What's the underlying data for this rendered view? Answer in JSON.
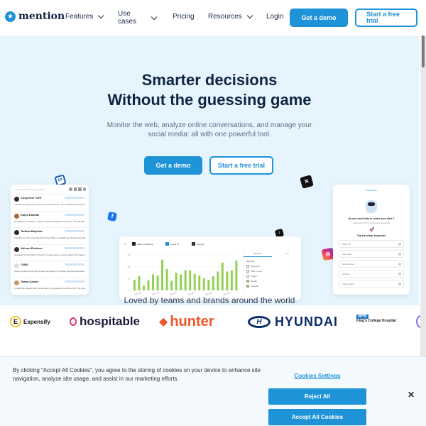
{
  "nav": {
    "logo": "mention",
    "items": [
      {
        "label": "Features",
        "has_dropdown": true
      },
      {
        "label": "Use cases",
        "has_dropdown": true
      },
      {
        "label": "Pricing",
        "has_dropdown": false
      },
      {
        "label": "Resources",
        "has_dropdown": true
      },
      {
        "label": "Login",
        "has_dropdown": false
      }
    ],
    "cta_demo": "Get a demo",
    "cta_trial": "Start a free trial"
  },
  "hero": {
    "title_line1": "Smarter  decisions",
    "title_line2": "Without the guessing game",
    "subtitle": "Monitor the web, analyze online conversations, and manage your social media: all with one powerful tool.",
    "cta_demo": "Get a demo",
    "cta_trial": "Start a free trial"
  },
  "mentions_panel": {
    "search_placeholder": "Explore and filter your mentions",
    "items": [
      {
        "name": "Cheyenne Torff",
        "text": "You can't imagine how I love my new iPhone15, I don't understand how I've lived without it all these years."
      },
      {
        "name": "Kaiya Dokidis",
        "text": "Hi Cellphone members, I spend my time looking at my screen. This OLED screen is just incredible.. Am I completely crazy or..."
      },
      {
        "name": "Tatiana Baptista",
        "text": "The iPhone 15 is undoubtedly the best iPhone of 2023! Its price/functionality ratio is finally correct, with its zoom, its 48..."
      },
      {
        "name": "Adison Ekstrom",
        "text": "Upgraded to the iPhone 15 and I'm loving every moment with it! The battery life is impressive, the display is stunning, and the..."
      },
      {
        "name": "CNBC",
        "text": "Apple reported fiscal first quarter earnings on Thursday that beat estimates for revenue and earnings. But it showed a 13% decline in sales..."
      },
      {
        "name": "Giana Carder",
        "text": "Couldn't be happier with my decision to upgrade to the iPhone 15. The enhanced features, such as the improved Face ID and t..."
      }
    ]
  },
  "chart_panel": {
    "alert": "Apple monitoring",
    "filter1": "Last 2 W",
    "filter2": "Per day",
    "tab_active": "Sources",
    "tab_other": "Tags",
    "legend_title": "Sources",
    "sources": [
      {
        "label": "Television",
        "checked": false
      },
      {
        "label": "Web / press",
        "checked": false
      },
      {
        "label": "Twitter",
        "checked": false
      },
      {
        "label": "Reddit",
        "checked": true
      },
      {
        "label": "Youtube",
        "checked": true
      }
    ]
  },
  "chart_data": {
    "type": "bar",
    "title": "",
    "xlabel": "",
    "ylabel": "",
    "ylim": [
      0,
      30
    ],
    "yticks": [
      "0",
      "10",
      "20",
      "30"
    ],
    "xtick_labels": [
      "Dec 18",
      "Dec 19",
      "Dec 20",
      "Dec 21",
      "Dec 22",
      "Dec 23"
    ],
    "values": [
      9,
      12,
      4,
      8.5,
      13.5,
      12.5,
      26,
      18,
      8,
      15,
      13.5,
      17,
      17,
      14,
      12.5,
      10,
      9,
      12,
      16,
      23.5,
      16,
      17,
      25
    ],
    "color": "#8fd14f"
  },
  "ai_panel": {
    "header": "AI Assistant",
    "question": "Do you need help to create your alert ?",
    "hint": "Check our TOP 5 to find your keywords",
    "trending_title": "Top trendings keywords",
    "keywords": [
      "Apple 15",
      "Mac book",
      "Smartphone",
      "AirPods",
      "Apple Watch"
    ]
  },
  "social_icons": [
    "linkedin-icon",
    "facebook-icon",
    "x-icon",
    "tiktok-icon",
    "instagram-icon"
  ],
  "loved_by": "Loved by teams and brands around the world",
  "logos": [
    "Expensify",
    "hospitable",
    "hunter",
    "HYUNDAI",
    "King's College Hospital"
  ],
  "cookie": {
    "text": "By clicking “Accept All Cookies”, you agree to the storing of cookies on your device to enhance site navigation, analyze site usage, and assist in our marketing efforts.",
    "settings": "Cookies Settings",
    "reject": "Reject All",
    "accept": "Accept All Cookies",
    "close": "✕"
  },
  "colors": {
    "accent": "#1e93d8",
    "hero_bg": "#e6f4fd",
    "heading": "#0f2542"
  }
}
